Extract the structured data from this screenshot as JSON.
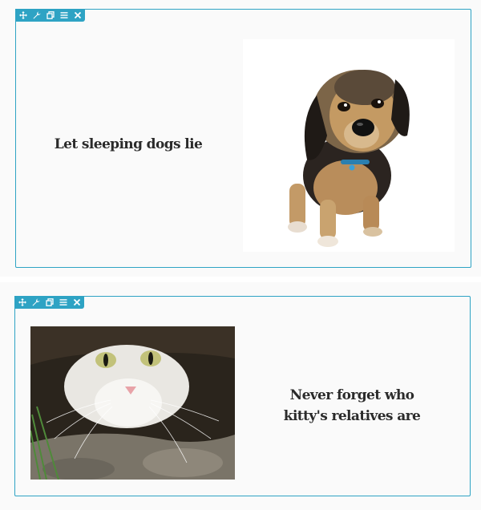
{
  "toolbar": {
    "icons": [
      "move-icon",
      "wrench-icon",
      "duplicate-icon",
      "menu-icon",
      "close-icon"
    ]
  },
  "blocks": [
    {
      "quote": "Let sleeping dogs lie",
      "image": "dog"
    },
    {
      "quote": "Never forget who kitty's relatives are",
      "image": "cat"
    }
  ],
  "colors": {
    "accent": "#2ea3c4",
    "section_bg": "#fafafa",
    "text": "#2b2b2b"
  }
}
